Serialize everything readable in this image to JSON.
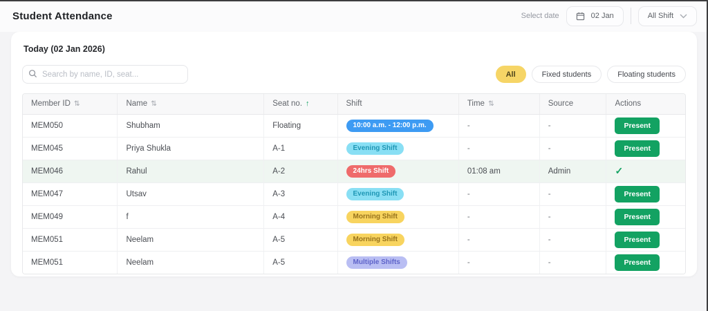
{
  "page": {
    "title": "Student Attendance"
  },
  "header": {
    "select_date_label": "Select date",
    "date_value": "02 Jan",
    "shift_filter_value": "All Shift"
  },
  "card": {
    "today_label": "Today (02 Jan 2026)",
    "search_placeholder": "Search by name, ID, seat...",
    "filters": [
      {
        "label": "All",
        "active": true
      },
      {
        "label": "Fixed students",
        "active": false
      },
      {
        "label": "Floating students",
        "active": false
      }
    ]
  },
  "table": {
    "columns": [
      {
        "label": "Member ID",
        "sort": "both",
        "width": "14.3%"
      },
      {
        "label": "Name",
        "sort": "both",
        "width": "22.1%"
      },
      {
        "label": "Seat no.",
        "sort": "asc",
        "width": "11.1%"
      },
      {
        "label": "Shift",
        "sort": "none",
        "width": "18.3%"
      },
      {
        "label": "Time",
        "sort": "both",
        "width": "12.2%"
      },
      {
        "label": "Source",
        "sort": "none",
        "width": "10.1%"
      },
      {
        "label": "Actions",
        "sort": "none",
        "width": "11.9%"
      }
    ],
    "rows": [
      {
        "member_id": "MEM050",
        "name": "Shubham",
        "seat": "Floating",
        "shift": {
          "label": "10:00 a.m. - 12:00 p.m.",
          "variant": "blue"
        },
        "time": "-",
        "source": "-",
        "action_type": "button",
        "action_label": "Present",
        "highlighted": false
      },
      {
        "member_id": "MEM045",
        "name": "Priya Shukla",
        "seat": "A-1",
        "shift": {
          "label": "Evening Shift",
          "variant": "cyan"
        },
        "time": "-",
        "source": "-",
        "action_type": "button",
        "action_label": "Present",
        "highlighted": false
      },
      {
        "member_id": "MEM046",
        "name": "Rahul",
        "seat": "A-2",
        "shift": {
          "label": "24hrs Shift",
          "variant": "red"
        },
        "time": "01:08 am",
        "source": "Admin",
        "action_type": "check",
        "action_label": "",
        "highlighted": true
      },
      {
        "member_id": "MEM047",
        "name": "Utsav",
        "seat": "A-3",
        "shift": {
          "label": "Evening Shift",
          "variant": "cyan"
        },
        "time": "-",
        "source": "-",
        "action_type": "button",
        "action_label": "Present",
        "highlighted": false
      },
      {
        "member_id": "MEM049",
        "name": "f",
        "seat": "A-4",
        "shift": {
          "label": "Morning Shift",
          "variant": "yellow"
        },
        "time": "-",
        "source": "-",
        "action_type": "button",
        "action_label": "Present",
        "highlighted": false
      },
      {
        "member_id": "MEM051",
        "name": "Neelam",
        "seat": "A-5",
        "shift": {
          "label": "Morning Shift",
          "variant": "yellow"
        },
        "time": "-",
        "source": "-",
        "action_type": "button",
        "action_label": "Present",
        "highlighted": false
      },
      {
        "member_id": "MEM051",
        "name": "Neelam",
        "seat": "A-5",
        "shift": {
          "label": "Multiple Shifts",
          "variant": "purple"
        },
        "time": "-",
        "source": "-",
        "action_type": "button",
        "action_label": "Present",
        "highlighted": false
      }
    ]
  },
  "icons": {
    "sort_both": "⇅",
    "sort_asc": "↑",
    "check": "✓"
  },
  "colors": {
    "green": "#13A262",
    "chip-yellow": "#F6D566",
    "badge-blue-bg": "#3D9BF3",
    "badge-cyan-bg": "#89DFF4",
    "badge-cyan-text": "#1F97B5",
    "badge-red-bg": "#EF6B6B",
    "badge-yellow-bg": "#F8D45F",
    "badge-yellow-text": "#97721B",
    "badge-purple-bg": "#B9BEF3",
    "badge-purple-text": "#5E63C9",
    "row-highlight": "#EFF6F1"
  }
}
